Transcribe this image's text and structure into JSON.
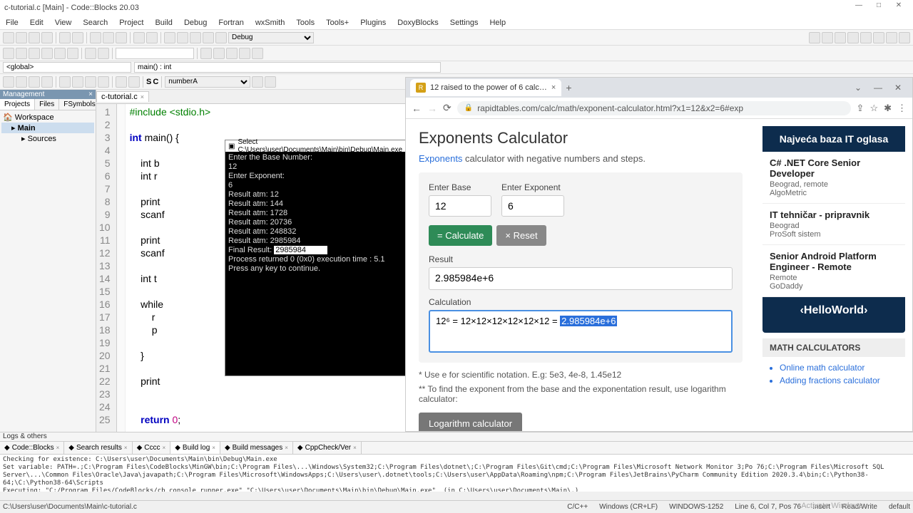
{
  "titlebar": {
    "title": "c-tutorial.c [Main] - Code::Blocks 20.03"
  },
  "menu": [
    "File",
    "Edit",
    "View",
    "Search",
    "Project",
    "Build",
    "Debug",
    "Fortran",
    "wxSmith",
    "Tools",
    "Tools+",
    "Plugins",
    "DoxyBlocks",
    "Settings",
    "Help"
  ],
  "scope": {
    "left": "<global>",
    "right": "main() : int"
  },
  "combo": {
    "debug": "Debug",
    "symbol": "numberA"
  },
  "mgmt": {
    "title": "Management",
    "tabs": [
      "Projects",
      "Files",
      "FSymbols"
    ],
    "tree": {
      "root": "Workspace",
      "proj": "Main",
      "src": "Sources"
    }
  },
  "file_tab": "c-tutorial.c",
  "code_lines": [
    {
      "n": "1",
      "t": "#include <stdio.h>",
      "c": "pre"
    },
    {
      "n": "2",
      "t": ""
    },
    {
      "n": "3",
      "t": "int main() {",
      "c": "kw"
    },
    {
      "n": "4",
      "t": ""
    },
    {
      "n": "5",
      "t": "    int b"
    },
    {
      "n": "6",
      "t": "    int r"
    },
    {
      "n": "7",
      "t": ""
    },
    {
      "n": "8",
      "t": "    print"
    },
    {
      "n": "9",
      "t": "    scanf"
    },
    {
      "n": "10",
      "t": ""
    },
    {
      "n": "11",
      "t": "    print"
    },
    {
      "n": "12",
      "t": "    scanf"
    },
    {
      "n": "13",
      "t": ""
    },
    {
      "n": "14",
      "t": "    int t"
    },
    {
      "n": "15",
      "t": ""
    },
    {
      "n": "16",
      "t": "    while"
    },
    {
      "n": "17",
      "t": "        r"
    },
    {
      "n": "18",
      "t": "        p"
    },
    {
      "n": "19",
      "t": "        "
    },
    {
      "n": "20",
      "t": "    }"
    },
    {
      "n": "21",
      "t": ""
    },
    {
      "n": "22",
      "t": "    print"
    },
    {
      "n": "23",
      "t": ""
    },
    {
      "n": "24",
      "t": ""
    },
    {
      "n": "25",
      "t": "    return 0;"
    }
  ],
  "console": {
    "title": "Select C:\\Users\\user\\Documents\\Main\\bin\\Debug\\Main.exe",
    "lines": [
      "Enter the Base Number:",
      "12",
      "Enter Exponent:",
      "6",
      "Result atm: 12",
      "Result atm: 144",
      "Result atm: 1728",
      "Result atm: 20736",
      "Result atm: 248832",
      "Result atm: 2985984"
    ],
    "final_label": "Final Result: ",
    "final_value": "2985984",
    "tail": [
      "",
      "Process returned 0 (0x0)   execution time : 5.1",
      "Press any key to continue."
    ]
  },
  "browser": {
    "tab": "12 raised to the power of 6 calc…",
    "url": "rapidtables.com/calc/math/exponent-calculator.html?x1=12&x2=6#exp",
    "h1": "Exponents Calculator",
    "sub_link": "Exponents",
    "sub_rest": " calculator with negative numbers and steps.",
    "lbl_base": "Enter Base",
    "lbl_exp": "Enter Exponent",
    "val_base": "12",
    "val_exp": "6",
    "btn_calc": "= Calculate",
    "btn_reset": "× Reset",
    "lbl_result": "Result",
    "result": "2.985984e+6",
    "lbl_calc": "Calculation",
    "calc_prefix": "12⁶ = 12×12×12×12×12×12 = ",
    "calc_hl": "2.985984e+6",
    "note1": "* Use e for scientific notation. E.g: 5e3, 4e-8, 1.45e12",
    "note2": "** To find the exponent from the base and the exponentation result, use logarithm calculator:",
    "btn_log": "Logarithm calculator",
    "ad_head": "Najveća baza IT oglasa",
    "jobs": [
      {
        "t": "C# .NET Core Senior Developer",
        "m1": "Beograd, remote",
        "m2": "AlgoMetric"
      },
      {
        "t": "IT tehničar - pripravnik",
        "m1": "Beograd",
        "m2": "ProSoft sistem"
      },
      {
        "t": "Senior Android Platform Engineer - Remote",
        "m1": "Remote",
        "m2": "GoDaddy"
      }
    ],
    "ad_foot": "‹HelloWorld›",
    "mc_head": "MATH CALCULATORS",
    "mc_items": [
      "Online math calculator",
      "Adding fractions calculator"
    ]
  },
  "logs": {
    "head": "Logs & others",
    "tabs": [
      "Code::Blocks",
      "Search results",
      "Cccc",
      "Build log",
      "Build messages",
      "CppCheck/Ver"
    ],
    "body": "Checking for existence: C:\\Users\\user\\Documents\\Main\\bin\\Debug\\Main.exe\nSet variable: PATH=.;C:\\Program Files\\CodeBlocks\\MinGW\\bin;C:\\Program Files\\...\\Windows\\System32;C:\\Program Files\\dotnet\\;C:\\Program Files\\Git\\cmd;C:\\Program Files\\Microsoft Network Monitor 3;Po 76;C:\\Program Files\\Microsoft SQL Server\\...\\Common Files\\Oracle\\Java\\javapath;C:\\Program Files\\Microsoft\\WindowsApps;C:\\Users\\user\\.dotnet\\tools;C:\\Users\\user\\AppData\\Roaming\\npm;C:\\Program Files\\JetBrains\\PyCharm Community Edition 2020.3.4\\bin;C:\\Python38-64;\\C:\\Python38-64\\Scripts\nExecuting: \"C:/Program Files/CodeBlocks/cb_console_runner.exe\" \"C:\\Users\\user\\Documents\\Main\\bin\\Debug\\Main.exe\"  (in C:\\Users\\user\\Documents\\Main\\.)"
  },
  "status": {
    "path": "C:\\Users\\user\\Documents\\Main\\c-tutorial.c",
    "lang": "C/C++",
    "enc": "Windows (CR+LF)",
    "cp": "WINDOWS-1252",
    "pos": "Line 6, Col 7, Pos 76",
    "ins": "Insert",
    "rw": "Read/Write",
    "def": "default"
  },
  "watermark": "Activate Windows"
}
